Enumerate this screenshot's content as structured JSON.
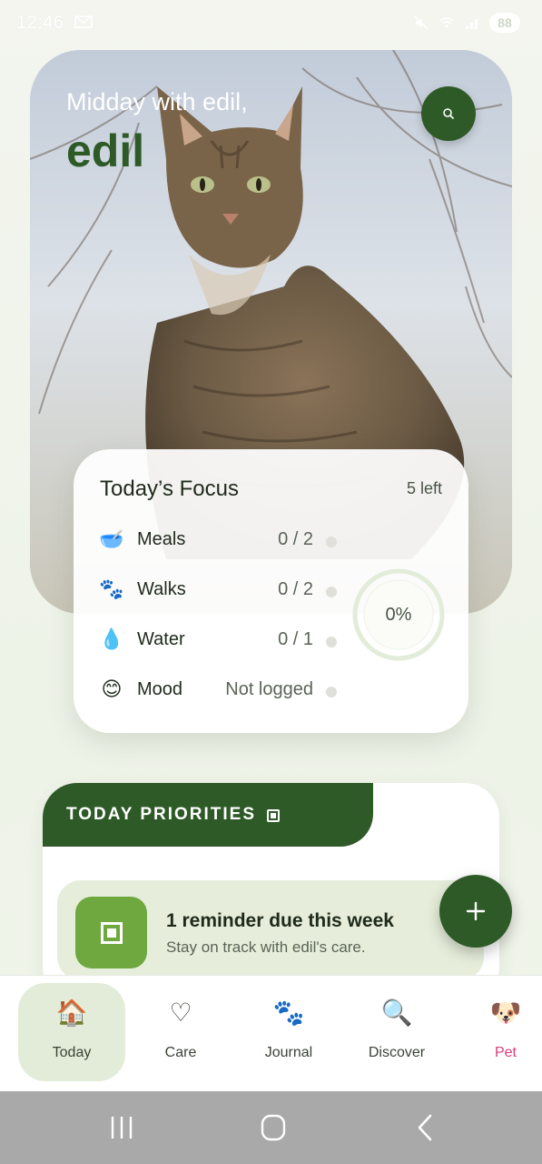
{
  "status_bar": {
    "time": "12:46",
    "battery": "88"
  },
  "hero": {
    "greeting": "Midday with edil,",
    "pet_name": "edil"
  },
  "focus": {
    "title": "Today’s Focus",
    "left": "5 left",
    "progress_label": "0%",
    "progress": 0,
    "rows": [
      {
        "emoji": "🥣",
        "label": "Meals",
        "value": "0 / 2"
      },
      {
        "emoji": "🐾",
        "label": "Walks",
        "value": "0 / 2"
      },
      {
        "emoji": "💧",
        "label": "Water",
        "value": "0 / 1"
      },
      {
        "emoji": "😊",
        "label": "Mood",
        "value": "Not logged"
      }
    ]
  },
  "priorities": {
    "title": "TODAY PRIORITIES",
    "reminder_title": "1 reminder due this week",
    "reminder_sub": "Stay on track with edil's care."
  },
  "nav": {
    "items": [
      {
        "label": "Today",
        "icon": "🏠"
      },
      {
        "label": "Care",
        "icon": "♡"
      },
      {
        "label": "Journal",
        "icon": "🐾"
      },
      {
        "label": "Discover",
        "icon": "🔍"
      },
      {
        "label": "Pet",
        "icon": "🐶"
      }
    ]
  },
  "colors": {
    "brand": "#2e5a27",
    "accent_green": "#6ea83f",
    "pet_pink": "#d6407a"
  }
}
